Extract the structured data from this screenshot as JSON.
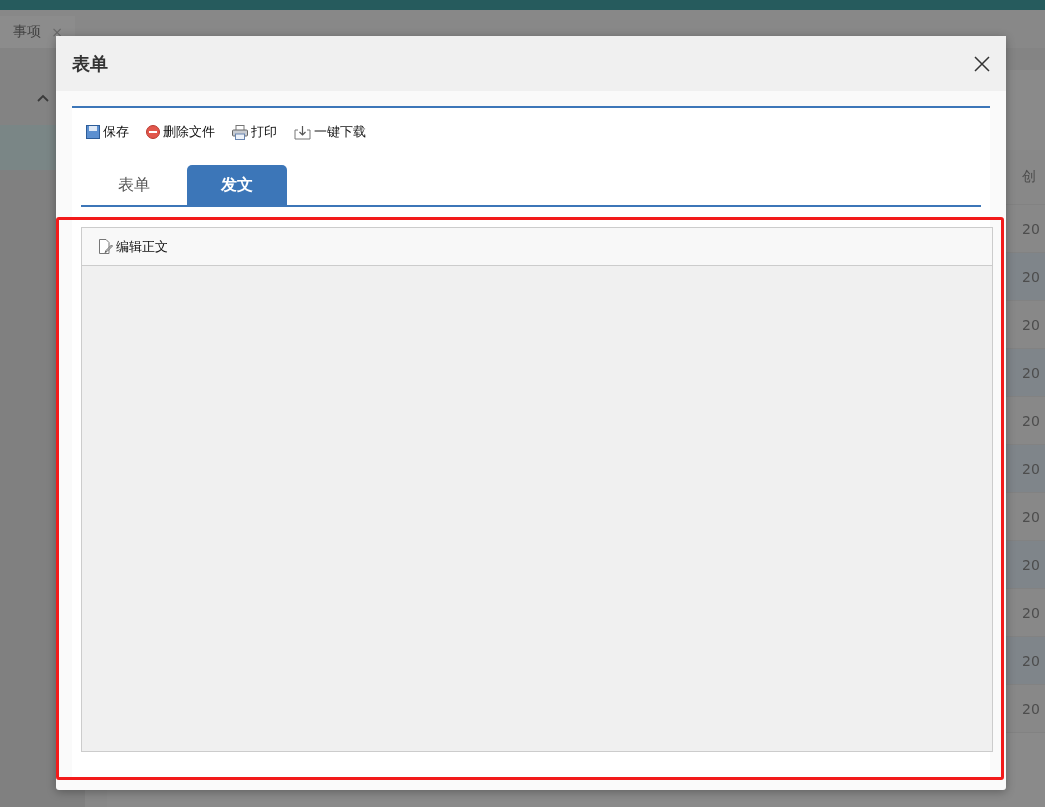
{
  "background": {
    "tab": {
      "label": "事项",
      "close": "×"
    },
    "sidebar": {
      "items": [
        {
          "kind": "group",
          "selected": false
        },
        {
          "kind": "item",
          "selected": true
        }
      ]
    },
    "table": {
      "column_1": "创",
      "rows": [
        "20",
        "20",
        "20",
        "20",
        "20",
        "20",
        "20",
        "20",
        "20",
        "20",
        "20"
      ]
    }
  },
  "modal": {
    "title": "表单",
    "toolbar": [
      {
        "kind": "save",
        "label": "保存"
      },
      {
        "kind": "delete",
        "label": "删除文件"
      },
      {
        "kind": "print",
        "label": "打印"
      },
      {
        "kind": "download",
        "label": "一键下载"
      }
    ],
    "tabs": [
      {
        "label": "表单",
        "selected": false
      },
      {
        "label": "发文",
        "selected": true
      }
    ],
    "editor": {
      "toolbar": [
        {
          "kind": "edit",
          "label": "编辑正文"
        }
      ]
    }
  }
}
